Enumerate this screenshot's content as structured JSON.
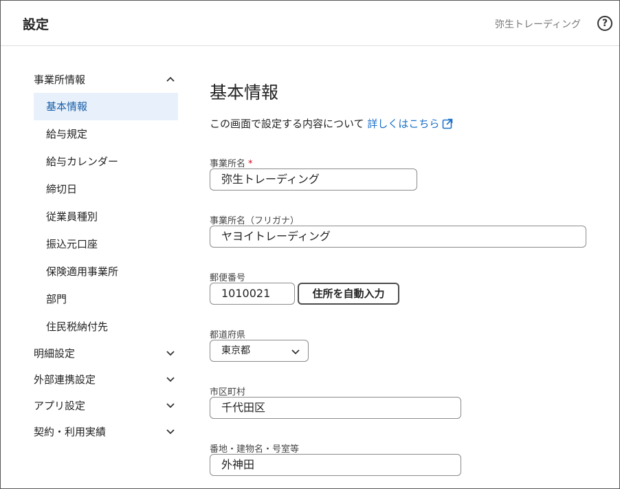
{
  "header": {
    "title": "設定",
    "company": "弥生トレーディング",
    "help_glyph": "?"
  },
  "sidebar": {
    "groups": [
      {
        "label": "事業所情報",
        "expanded": true,
        "items": [
          {
            "label": "基本情報",
            "active": true
          },
          {
            "label": "給与規定"
          },
          {
            "label": "給与カレンダー"
          },
          {
            "label": "締切日"
          },
          {
            "label": "従業員種別"
          },
          {
            "label": "振込元口座"
          },
          {
            "label": "保険適用事業所"
          },
          {
            "label": "部門"
          },
          {
            "label": "住民税納付先"
          }
        ]
      },
      {
        "label": "明細設定",
        "expanded": false
      },
      {
        "label": "外部連携設定",
        "expanded": false
      },
      {
        "label": "アプリ設定",
        "expanded": false
      },
      {
        "label": "契約・利用実績",
        "expanded": false
      }
    ]
  },
  "main": {
    "section_title": "基本情報",
    "description": "この画面で設定する内容について",
    "description_link": "詳しくはこちら",
    "fields": {
      "office_name": {
        "label": "事業所名",
        "required_mark": "*",
        "value": "弥生トレーディング"
      },
      "office_kana": {
        "label": "事業所名（フリガナ）",
        "value": "ヤヨイトレーディング"
      },
      "postal_code": {
        "label": "郵便番号",
        "value": "1010021",
        "button": "住所を自動入力"
      },
      "prefecture": {
        "label": "都道府県",
        "value": "東京都"
      },
      "city": {
        "label": "市区町村",
        "value": "千代田区"
      },
      "address": {
        "label": "番地・建物名・号室等",
        "value": "外神田"
      }
    }
  },
  "colors": {
    "accent": "#1a6fc9",
    "active_bg": "#e8f1fb",
    "required": "#d0021b"
  }
}
